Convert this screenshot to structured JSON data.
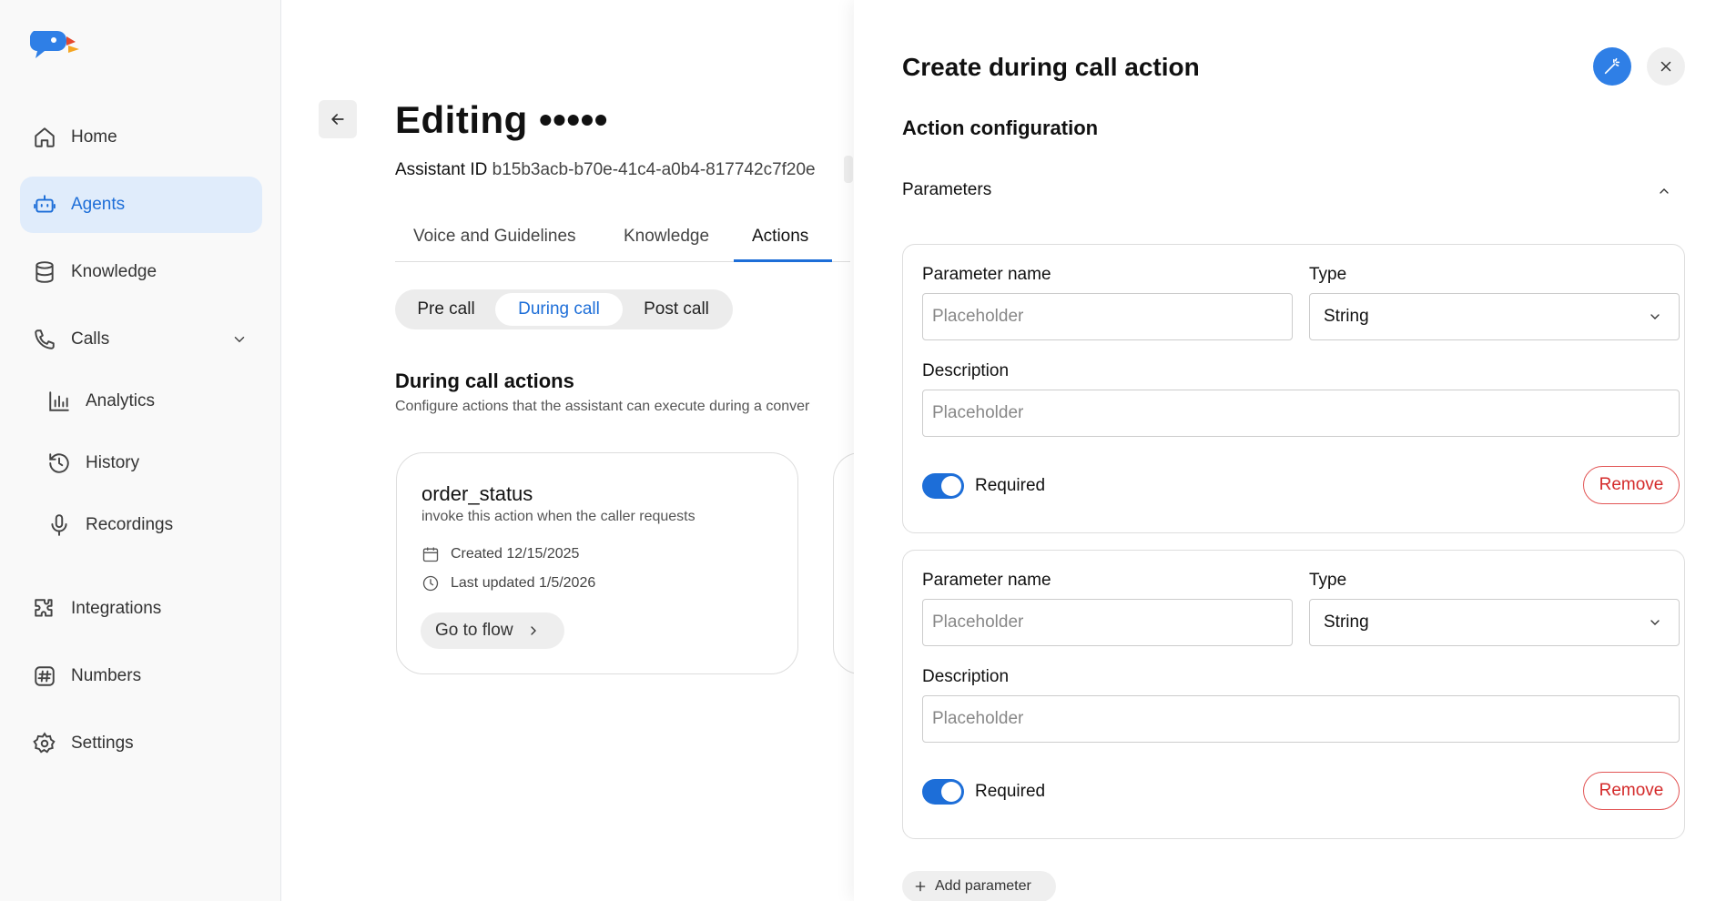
{
  "sidebar": {
    "items": [
      {
        "label": "Home"
      },
      {
        "label": "Agents"
      },
      {
        "label": "Knowledge"
      },
      {
        "label": "Calls"
      },
      {
        "label": "Analytics"
      },
      {
        "label": "History"
      },
      {
        "label": "Recordings"
      },
      {
        "label": "Integrations"
      },
      {
        "label": "Numbers"
      },
      {
        "label": "Settings"
      }
    ],
    "active": "Agents"
  },
  "main": {
    "title": "Editing •••••",
    "assistant_id_label": "Assistant ID",
    "assistant_id_value": "b15b3acb-b70e-41c4-a0b4-817742c7f20e",
    "tabs": [
      {
        "label": "Voice and Guidelines"
      },
      {
        "label": "Knowledge"
      },
      {
        "label": "Actions"
      }
    ],
    "active_tab": "Actions",
    "segments": [
      {
        "label": "Pre call"
      },
      {
        "label": "During call"
      },
      {
        "label": "Post call"
      }
    ],
    "active_segment": "During call",
    "section_title": "During call actions",
    "section_desc": "Configure actions that the assistant can execute during a conver",
    "cards": [
      {
        "title": "order_status",
        "desc": "invoke this action when the caller requests",
        "created": "Created 12/15/2025",
        "updated": "Last updated 1/5/2026",
        "button": "Go to flow"
      }
    ]
  },
  "panel": {
    "title": "Create during call action",
    "subhead": "Action configuration",
    "parameters_label": "Parameters",
    "params": [
      {
        "name_label": "Parameter name",
        "name_placeholder": "Placeholder",
        "type_label": "Type",
        "type_value": "String",
        "desc_label": "Description",
        "desc_placeholder": "Placeholder",
        "required_label": "Required",
        "required": true,
        "remove_label": "Remove"
      },
      {
        "name_label": "Parameter name",
        "name_placeholder": "Placeholder",
        "type_label": "Type",
        "type_value": "String",
        "desc_label": "Description",
        "desc_placeholder": "Placeholder",
        "required_label": "Required",
        "required": true,
        "remove_label": "Remove"
      }
    ],
    "add_parameter_label": "Add parameter"
  },
  "colors": {
    "accent": "#1d6ed8",
    "active_nav_bg": "#e0ecfb",
    "danger": "#d42a2a"
  }
}
